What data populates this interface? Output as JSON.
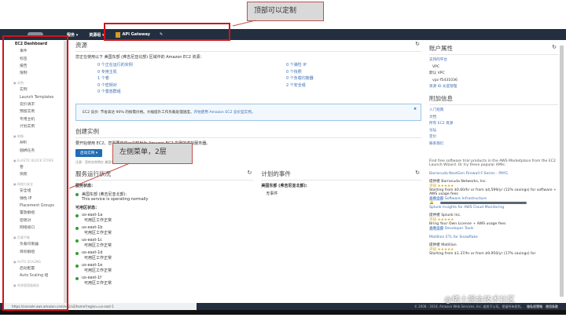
{
  "annotations": {
    "top": "顶部可以定制",
    "left": "左侧菜单，2层"
  },
  "nav": {
    "services": "服务 ▾",
    "resource_groups": "资源组 ▾",
    "pinned": "API Gateway",
    "pin_icon": "pin-icon",
    "bell": "🔔"
  },
  "sidebar": {
    "items": [
      {
        "t": "EC2 Dashboard",
        "h": false
      },
      {
        "t": "事件",
        "h": false
      },
      {
        "t": "标签",
        "h": false
      },
      {
        "t": "报告",
        "h": false
      },
      {
        "t": "限制",
        "h": false
      },
      {
        "t": "▣ 实例",
        "h": true
      },
      {
        "t": "实例",
        "h": false
      },
      {
        "t": "Launch Templates",
        "h": false
      },
      {
        "t": "竞价请求",
        "h": false
      },
      {
        "t": "预留实例",
        "h": false
      },
      {
        "t": "专用主机",
        "h": false
      },
      {
        "t": "计划实例",
        "h": false
      },
      {
        "t": "▣ 映像",
        "h": true
      },
      {
        "t": "AMI",
        "h": false
      },
      {
        "t": "捆绑任务",
        "h": false
      },
      {
        "t": "▣ ELASTIC BLOCK STORE",
        "h": true
      },
      {
        "t": "卷",
        "h": false
      },
      {
        "t": "快照",
        "h": false
      },
      {
        "t": "▣ 网络与安全",
        "h": true
      },
      {
        "t": "安全组",
        "h": false
      },
      {
        "t": "弹性 IP",
        "h": false
      },
      {
        "t": "Placement Groups",
        "h": false
      },
      {
        "t": "置放群组",
        "h": false
      },
      {
        "t": "密钥对",
        "h": false
      },
      {
        "t": "网络接口",
        "h": false
      },
      {
        "t": "▣ 负载平衡",
        "h": true
      },
      {
        "t": "负载均衡器",
        "h": false
      },
      {
        "t": "目标群组",
        "h": false
      },
      {
        "t": "▣ AUTO SCALING",
        "h": true
      },
      {
        "t": "启动配置",
        "h": false
      },
      {
        "t": "Auto Scaling 组",
        "h": false
      },
      {
        "t": "▣ 系统管理器服务",
        "h": true
      }
    ]
  },
  "resources": {
    "title": "资源",
    "intro": "您正在使用以下 美国东部 (弗吉尼亚北部) 区域中的 Amazon EC2 资源：",
    "left": [
      "0 个正在运行的实例",
      "0 专用主机",
      "1 个卷",
      "0 个密钥对",
      "0 个置放群组"
    ],
    "right": [
      "0 个弹性 IP",
      "0 个快照",
      "0 个负载均衡器",
      "2 个安全组"
    ]
  },
  "alert": {
    "text": "EC2 竞价: 节省高达 90% 的按需价格。大幅提升工作负载处理速度。",
    "link": "开始使用 Amazon EC2 竞价型实例。",
    "close": "✖"
  },
  "create": {
    "title": "创建实例",
    "desc": "要开始使用 EC2，您需要启动一个映射为 Amazon EC2 实例的虚拟服务器。",
    "button": "启动实例 ▾",
    "note": "注意：您的实例将在 美国东部 (弗吉尼亚北部) 区域中启动"
  },
  "health": {
    "title": "服务运行状况",
    "service_label": "服务状态：",
    "region": "美国东部 (弗吉尼亚北部):",
    "region_status": "This service is operating normally",
    "az_label": "可用区状态：",
    "zones": [
      {
        "n": "us-east-1a",
        "s": "可用区工作正常"
      },
      {
        "n": "us-east-1b",
        "s": "可用区工作正常"
      },
      {
        "n": "us-east-1c",
        "s": "可用区工作正常"
      },
      {
        "n": "us-east-1d",
        "s": "可用区工作正常"
      },
      {
        "n": "us-east-1e",
        "s": "可用区工作正常"
      },
      {
        "n": "us-east-1f",
        "s": "可用区工作正常"
      }
    ]
  },
  "events": {
    "title": "计划的事件",
    "region": "美国东部 (弗吉尼亚北部):",
    "none": "无事件"
  },
  "account": {
    "title": "账户属性",
    "platforms_label": "支持的平台",
    "platforms": "VPC",
    "default_vpc_label": "默认 VPC",
    "default_vpc": "vpc-f5431036",
    "console": "资源 ID 长度管理"
  },
  "info": {
    "title": "附加信息",
    "links": [
      "入门指南",
      "文档",
      "所有 EC2 资源",
      "论坛",
      "定价",
      "联系我们"
    ]
  },
  "marketplace": {
    "intro": "Find free software trial products in the AWS Marketplace from the EC2 Launch Wizard. Or try these popular AMIs:",
    "products": [
      {
        "name": "Barracuda NextGen Firewall F-Series - PAYG",
        "vendor": "提供者 Barracuda Networks, Inc.",
        "rating": "评级 ★★★★★",
        "price": "Starting from $0.60/hr or from $4,599/yr (12% savings) for software + AWS usage fees",
        "view": "查看全部",
        "cat": "Software Infrastructure"
      },
      {
        "name": "Splunk Insights for AWS Cloud Monitoring",
        "vendor": "提供者 Splunk Inc.",
        "rating": "评级 ★★★★★",
        "price": "Bring Your Own License + AWS usage fees",
        "view": "查看全部",
        "cat": "Developer Tools"
      },
      {
        "name": "Matillion ETL for Snowflake",
        "vendor": "提供者 Matillion",
        "rating": "评级 ★★★★★",
        "price": "Starting from $1.37/hr or from $9,950/yr (17% savings) for",
        "view": "",
        "cat": ""
      }
    ]
  },
  "footer": {
    "copy": "© 2008 - 2018, Amazon Web Services, Inc. 或其子公司。保留所有权利。",
    "privacy": "隐私权策略",
    "terms": "使用条款"
  },
  "statusbar": "https://console.aws.amazon.com/ec2/v2/home?region=us-east-1",
  "watermark": "@稀土掘金技术社区"
}
